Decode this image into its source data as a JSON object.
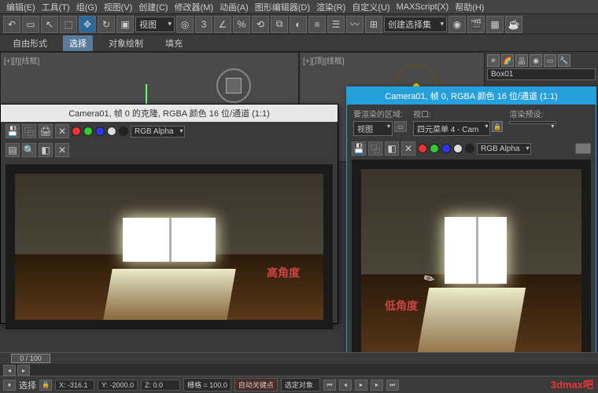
{
  "menu": {
    "edit": "编辑(E)",
    "tools": "工具(T)",
    "group": "组(G)",
    "views": "视图(V)",
    "create": "创建(C)",
    "modifiers": "修改器(M)",
    "animation": "动画(A)",
    "graph": "图形编辑器(D)",
    "rendering": "渲染(R)",
    "customize": "自定义(U)",
    "maxscript": "MAXScript(X)",
    "help": "帮助(H)"
  },
  "toolbar": {
    "viewdrop": "视图",
    "selset": "创建选择集"
  },
  "subbar": {
    "free": "自由形式",
    "select": "选择",
    "paint": "对象绘制",
    "fill": "填充"
  },
  "viewport": {
    "left_label": "[+][f][线框]",
    "right_label": "[+][顶][线框]"
  },
  "render1": {
    "title": "Camera01, 帧 0 的克隆, RGBA 颜色 16 位/通道 (1:1)",
    "rgb": "RGB Alpha",
    "anno": "高角度"
  },
  "render2": {
    "title": "Camera01, 帧 0, RGBA 颜色 16 位/通道 (1:1)",
    "area_lbl": "要渲染的区域:",
    "area_val": "视图",
    "viewport_lbl": "视口:",
    "viewport_val": "四元菜单 4 - Cam",
    "preset_lbl": "渲染预设:",
    "rgb": "RGB Alpha",
    "anno": "低角度"
  },
  "side": {
    "obj": "Box01"
  },
  "timeline": {
    "frame": "0 / 100"
  },
  "status": {
    "sel": "选择",
    "x": "X: -316.1",
    "y": "Y: -2000.0",
    "z": "Z: 0.0",
    "grid": "栅格 = 100.0",
    "autokey": "自动关键点",
    "selfilter": "选定对象"
  },
  "watermark": "3dmax吧"
}
